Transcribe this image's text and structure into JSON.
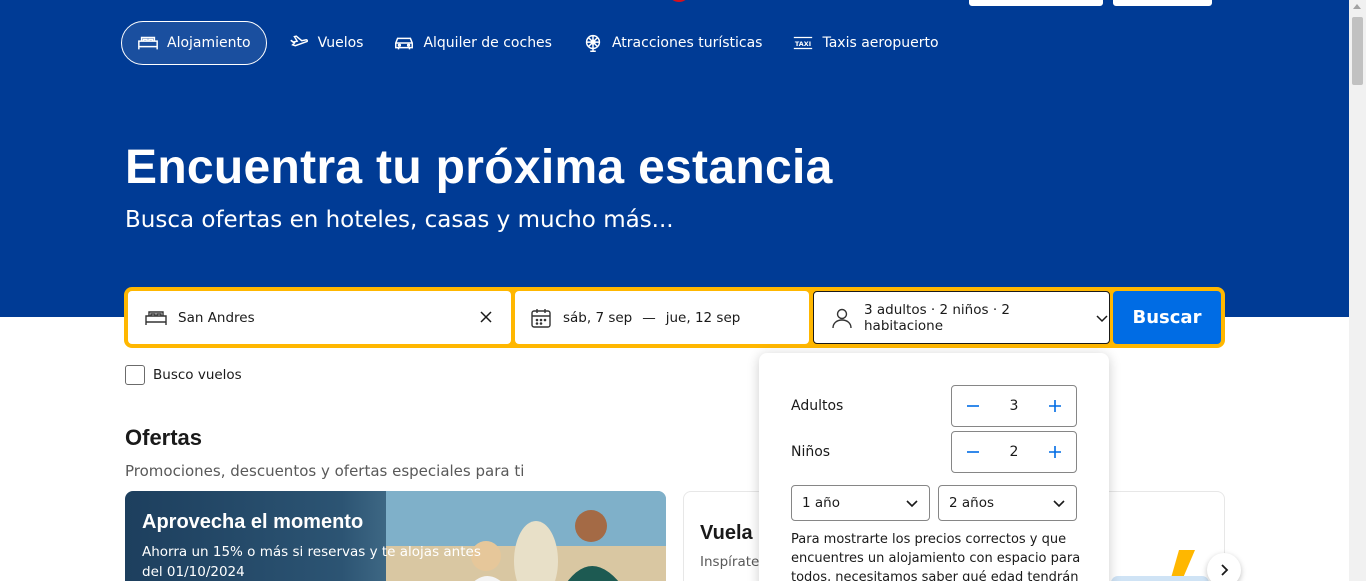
{
  "nav": {
    "items": [
      {
        "label": "Alojamiento",
        "icon": "bed-icon",
        "active": true
      },
      {
        "label": "Vuelos",
        "icon": "plane-icon"
      },
      {
        "label": "Alquiler de coches",
        "icon": "car-icon"
      },
      {
        "label": "Atracciones turísticas",
        "icon": "attractions-icon"
      },
      {
        "label": "Taxis aeropuerto",
        "icon": "taxi-icon"
      }
    ]
  },
  "hero": {
    "title": "Encuentra tu próxima estancia",
    "subtitle": "Busca ofertas en hoteles, casas y mucho más..."
  },
  "search": {
    "destination": "San Andres",
    "checkin": "sáb, 7 sep",
    "separator": "—",
    "checkout": "jue, 12 sep",
    "occupancy": "3 adultos · 2 niños · 2 habitacione",
    "button": "Buscar",
    "flights_checkbox": "Busco vuelos"
  },
  "occupancy_popover": {
    "adults_label": "Adultos",
    "adults_value": "3",
    "children_label": "Niños",
    "children_value": "2",
    "child_ages": [
      "1 año",
      "2 años"
    ],
    "note": "Para mostrarte los precios correctos y que encuentres un alojamiento con espacio para todos, necesitamos saber qué edad tendrán"
  },
  "offers": {
    "title": "Ofertas",
    "subtitle": "Promociones, descuentos y ofertas especiales para ti",
    "card1": {
      "title": "Aprovecha el momento",
      "text": "Ahorra un 15% o más si reservas y te alojas antes del 01/10/2024"
    },
    "card2": {
      "title": "Vuela",
      "text": "Inspírate,"
    }
  },
  "colors": {
    "brand_blue": "#003b95",
    "search_yellow": "#ffb700",
    "button_blue": "#006ce4"
  }
}
